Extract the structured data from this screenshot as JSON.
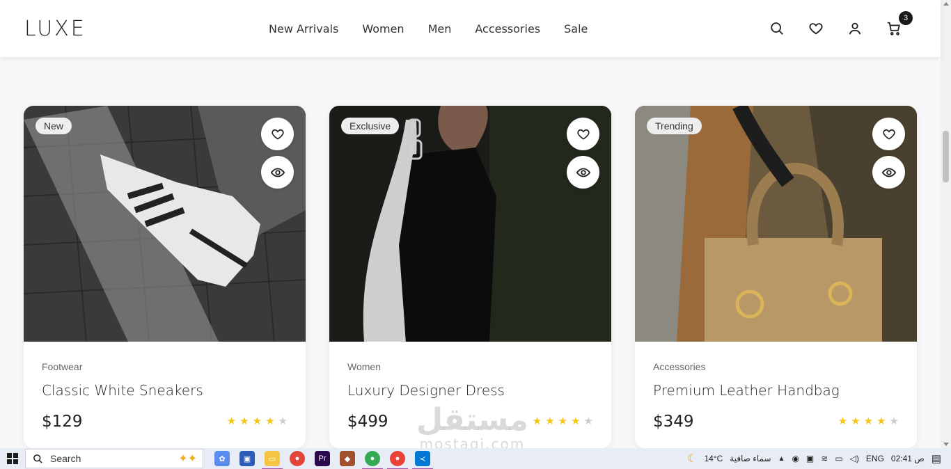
{
  "header": {
    "logo": "LUXE",
    "nav": [
      "New Arrivals",
      "Women",
      "Men",
      "Accessories",
      "Sale"
    ],
    "cart_count": "3"
  },
  "products": [
    {
      "badge": "New",
      "category": "Footwear",
      "title": "Classic White Sneakers",
      "price": "$129",
      "rating": 4,
      "rating_max": 5
    },
    {
      "badge": "Exclusive",
      "category": "Women",
      "title": "Luxury Designer Dress",
      "price": "$499",
      "rating": 4,
      "rating_max": 5
    },
    {
      "badge": "Trending",
      "category": "Accessories",
      "title": "Premium Leather Handbag",
      "price": "$349",
      "rating": 4,
      "rating_max": 5
    }
  ],
  "watermark": {
    "arabic": "مستقل",
    "latin": "mostaqi.com"
  },
  "taskbar": {
    "search_label": "Search",
    "weather_temp": "14°C",
    "weather_text": "سماء صافية",
    "language": "ENG",
    "time": "02:41 ص"
  },
  "colors": {
    "star": "#f5c518",
    "star_empty": "#cccccc",
    "badge_bg": "#eeeeee"
  }
}
